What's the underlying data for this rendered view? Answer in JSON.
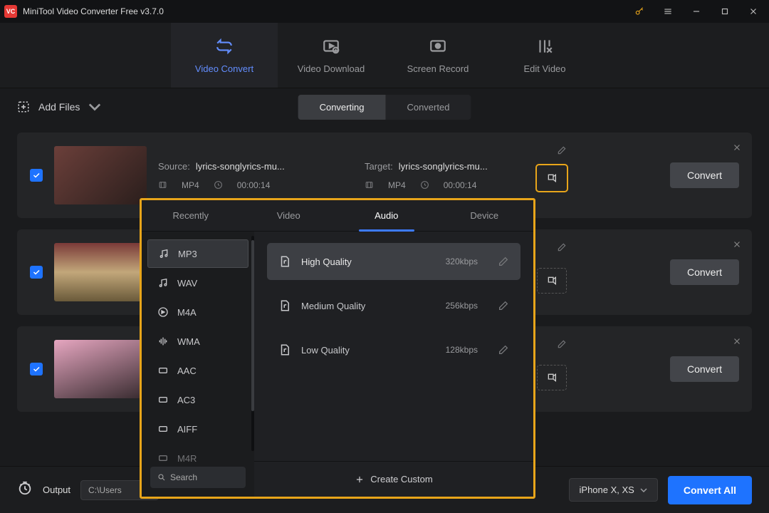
{
  "app": {
    "title": "MiniTool Video Converter Free v3.7.0"
  },
  "nav": {
    "convert": "Video Convert",
    "download": "Video Download",
    "record": "Screen Record",
    "edit": "Edit Video"
  },
  "toolbar": {
    "add_files": "Add Files",
    "converting": "Converting",
    "converted": "Converted"
  },
  "rows": {
    "source_lbl": "Source:",
    "target_lbl": "Target:",
    "filename": "lyrics-songlyrics-mu...",
    "codec": "MP4",
    "duration": "00:00:14",
    "convert_btn": "Convert"
  },
  "popup": {
    "tabs": {
      "recent": "Recently",
      "video": "Video",
      "audio": "Audio",
      "device": "Device"
    },
    "formats": {
      "mp3": "MP3",
      "wav": "WAV",
      "m4a": "M4A",
      "wma": "WMA",
      "aac": "AAC",
      "ac3": "AC3",
      "aiff": "AIFF",
      "m4r": "M4R"
    },
    "qualities": {
      "high": "High Quality",
      "high_rate": "320kbps",
      "med": "Medium Quality",
      "med_rate": "256kbps",
      "low": "Low Quality",
      "low_rate": "128kbps"
    },
    "search": "Search",
    "create": "Create Custom"
  },
  "bottom": {
    "output_lbl": "Output",
    "output_path": "C:\\Users",
    "device": "iPhone X, XS",
    "convert_all": "Convert All"
  }
}
